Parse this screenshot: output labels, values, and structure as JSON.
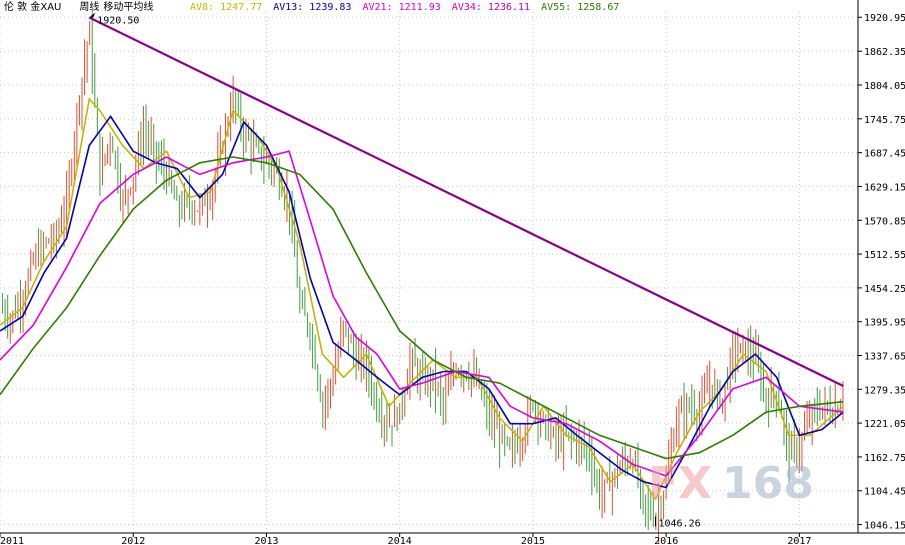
{
  "window": {
    "title_prefix": "伦 敦 金XAU",
    "period": "周线",
    "indicator": "移动平均线"
  },
  "legend": [
    {
      "label": "AV8: 1247.77",
      "color": "#c8b400"
    },
    {
      "label": "AV13: 1239.83",
      "color": "#0000c0"
    },
    {
      "label": "AV21: 1211.93",
      "color": "#e000e0"
    },
    {
      "label": "AV34: 1236.11",
      "color": "#c000c0"
    },
    {
      "label": "AV55: 1258.67",
      "color": "#2e7d00"
    }
  ],
  "annotations": {
    "high_label": "1920.50",
    "low_label": "1046.26"
  },
  "watermark": {
    "text_a": "FX",
    "text_b": "168"
  },
  "colors": {
    "up_candle": "#e05030",
    "down_candle": "#40a040",
    "ma8": "#c8b400",
    "ma13": "#0000c0",
    "ma21": "#e000e0",
    "ma34": "#c000c0",
    "ma55": "#2e7d00",
    "trendline": "#8a008a"
  },
  "chart_data": {
    "type": "candlestick",
    "title": "",
    "y_ticks": [
      "1920.95",
      "1862.35",
      "1804.05",
      "1745.75",
      "1687.45",
      "1629.15",
      "1570.85",
      "1512.55",
      "1454.25",
      "1395.95",
      "1337.65",
      "1279.35",
      "1221.05",
      "1162.75",
      "1104.45",
      "1046.15"
    ],
    "ylim": [
      1035,
      1930
    ],
    "x_ticks": [
      {
        "label": "2011",
        "x": 2011.0
      },
      {
        "label": "2012",
        "x": 2012.0
      },
      {
        "label": "2013",
        "x": 2013.0
      },
      {
        "label": "2014",
        "x": 2014.0
      },
      {
        "label": "2015",
        "x": 2015.0
      },
      {
        "label": "2016",
        "x": 2016.0
      },
      {
        "label": "2017",
        "x": 2017.0
      }
    ],
    "xlim": [
      2011.0,
      2017.35
    ],
    "high": {
      "x": 2011.67,
      "y": 1920.5
    },
    "low": {
      "x": 2015.92,
      "y": 1046.26
    },
    "trendline": {
      "x": [
        2011.67,
        2017.33
      ],
      "y": [
        1920.5,
        1285
      ]
    },
    "price_path": [
      [
        2011.0,
        1420
      ],
      [
        2011.08,
        1400
      ],
      [
        2011.17,
        1440
      ],
      [
        2011.25,
        1500
      ],
      [
        2011.33,
        1530
      ],
      [
        2011.42,
        1540
      ],
      [
        2011.5,
        1600
      ],
      [
        2011.58,
        1760
      ],
      [
        2011.67,
        1900
      ],
      [
        2011.75,
        1650
      ],
      [
        2011.83,
        1720
      ],
      [
        2011.92,
        1600
      ],
      [
        2012.0,
        1650
      ],
      [
        2012.08,
        1730
      ],
      [
        2012.17,
        1680
      ],
      [
        2012.25,
        1650
      ],
      [
        2012.33,
        1590
      ],
      [
        2012.42,
        1600
      ],
      [
        2012.5,
        1590
      ],
      [
        2012.58,
        1620
      ],
      [
        2012.67,
        1700
      ],
      [
        2012.75,
        1780
      ],
      [
        2012.83,
        1720
      ],
      [
        2012.92,
        1690
      ],
      [
        2013.0,
        1670
      ],
      [
        2013.08,
        1650
      ],
      [
        2013.17,
        1600
      ],
      [
        2013.25,
        1420
      ],
      [
        2013.33,
        1380
      ],
      [
        2013.42,
        1250
      ],
      [
        2013.5,
        1300
      ],
      [
        2013.58,
        1390
      ],
      [
        2013.67,
        1330
      ],
      [
        2013.75,
        1320
      ],
      [
        2013.83,
        1250
      ],
      [
        2013.92,
        1220
      ],
      [
        2014.0,
        1240
      ],
      [
        2014.08,
        1330
      ],
      [
        2014.17,
        1290
      ],
      [
        2014.25,
        1300
      ],
      [
        2014.33,
        1250
      ],
      [
        2014.42,
        1320
      ],
      [
        2014.5,
        1310
      ],
      [
        2014.58,
        1290
      ],
      [
        2014.67,
        1230
      ],
      [
        2014.75,
        1200
      ],
      [
        2014.83,
        1170
      ],
      [
        2014.92,
        1200
      ],
      [
        2015.0,
        1260
      ],
      [
        2015.08,
        1220
      ],
      [
        2015.17,
        1190
      ],
      [
        2015.25,
        1200
      ],
      [
        2015.33,
        1190
      ],
      [
        2015.42,
        1170
      ],
      [
        2015.5,
        1100
      ],
      [
        2015.58,
        1120
      ],
      [
        2015.67,
        1150
      ],
      [
        2015.75,
        1160
      ],
      [
        2015.83,
        1080
      ],
      [
        2015.92,
        1060
      ],
      [
        2016.0,
        1120
      ],
      [
        2016.08,
        1230
      ],
      [
        2016.17,
        1250
      ],
      [
        2016.25,
        1240
      ],
      [
        2016.33,
        1290
      ],
      [
        2016.42,
        1260
      ],
      [
        2016.5,
        1340
      ],
      [
        2016.58,
        1350
      ],
      [
        2016.67,
        1330
      ],
      [
        2016.75,
        1260
      ],
      [
        2016.83,
        1280
      ],
      [
        2016.92,
        1170
      ],
      [
        2017.0,
        1180
      ],
      [
        2017.08,
        1230
      ],
      [
        2017.17,
        1250
      ],
      [
        2017.25,
        1240
      ],
      [
        2017.33,
        1265
      ]
    ],
    "series": [
      {
        "name": "AV8",
        "color_key": "ma8",
        "values": [
          [
            2011.0,
            1390
          ],
          [
            2011.17,
            1420
          ],
          [
            2011.33,
            1500
          ],
          [
            2011.5,
            1560
          ],
          [
            2011.67,
            1780
          ],
          [
            2011.75,
            1760
          ],
          [
            2011.92,
            1700
          ],
          [
            2012.08,
            1660
          ],
          [
            2012.25,
            1690
          ],
          [
            2012.42,
            1610
          ],
          [
            2012.58,
            1620
          ],
          [
            2012.75,
            1760
          ],
          [
            2012.92,
            1720
          ],
          [
            2013.08,
            1660
          ],
          [
            2013.25,
            1530
          ],
          [
            2013.42,
            1340
          ],
          [
            2013.58,
            1300
          ],
          [
            2013.75,
            1340
          ],
          [
            2013.92,
            1250
          ],
          [
            2014.08,
            1290
          ],
          [
            2014.25,
            1330
          ],
          [
            2014.42,
            1300
          ],
          [
            2014.58,
            1300
          ],
          [
            2014.75,
            1230
          ],
          [
            2014.92,
            1190
          ],
          [
            2015.08,
            1250
          ],
          [
            2015.25,
            1200
          ],
          [
            2015.42,
            1180
          ],
          [
            2015.58,
            1120
          ],
          [
            2015.75,
            1150
          ],
          [
            2015.92,
            1090
          ],
          [
            2016.08,
            1170
          ],
          [
            2016.25,
            1240
          ],
          [
            2016.42,
            1280
          ],
          [
            2016.58,
            1340
          ],
          [
            2016.75,
            1310
          ],
          [
            2016.92,
            1200
          ],
          [
            2017.08,
            1200
          ],
          [
            2017.33,
            1250
          ]
        ]
      },
      {
        "name": "AV13",
        "color_key": "ma13",
        "values": [
          [
            2011.0,
            1380
          ],
          [
            2011.17,
            1405
          ],
          [
            2011.33,
            1480
          ],
          [
            2011.5,
            1540
          ],
          [
            2011.67,
            1700
          ],
          [
            2011.83,
            1750
          ],
          [
            2012.0,
            1690
          ],
          [
            2012.17,
            1670
          ],
          [
            2012.33,
            1660
          ],
          [
            2012.5,
            1610
          ],
          [
            2012.67,
            1650
          ],
          [
            2012.83,
            1740
          ],
          [
            2013.0,
            1700
          ],
          [
            2013.17,
            1620
          ],
          [
            2013.33,
            1470
          ],
          [
            2013.5,
            1360
          ],
          [
            2013.67,
            1330
          ],
          [
            2013.83,
            1300
          ],
          [
            2014.0,
            1270
          ],
          [
            2014.17,
            1300
          ],
          [
            2014.33,
            1310
          ],
          [
            2014.5,
            1310
          ],
          [
            2014.67,
            1280
          ],
          [
            2014.83,
            1220
          ],
          [
            2015.0,
            1220
          ],
          [
            2015.17,
            1230
          ],
          [
            2015.33,
            1200
          ],
          [
            2015.5,
            1170
          ],
          [
            2015.67,
            1140
          ],
          [
            2015.83,
            1120
          ],
          [
            2016.0,
            1110
          ],
          [
            2016.17,
            1180
          ],
          [
            2016.33,
            1250
          ],
          [
            2016.5,
            1310
          ],
          [
            2016.67,
            1340
          ],
          [
            2016.83,
            1300
          ],
          [
            2017.0,
            1200
          ],
          [
            2017.17,
            1210
          ],
          [
            2017.33,
            1240
          ]
        ]
      },
      {
        "name": "AV21",
        "color_key": "ma21",
        "values": [
          [
            2011.0,
            1330
          ],
          [
            2011.25,
            1390
          ],
          [
            2011.5,
            1490
          ],
          [
            2011.75,
            1600
          ],
          [
            2012.0,
            1650
          ],
          [
            2012.25,
            1680
          ],
          [
            2012.5,
            1650
          ],
          [
            2012.75,
            1670
          ],
          [
            2013.0,
            1680
          ],
          [
            2013.17,
            1690
          ],
          [
            2013.33,
            1570
          ],
          [
            2013.5,
            1440
          ],
          [
            2013.67,
            1370
          ],
          [
            2013.83,
            1340
          ],
          [
            2014.0,
            1280
          ],
          [
            2014.17,
            1290
          ],
          [
            2014.42,
            1310
          ],
          [
            2014.67,
            1300
          ],
          [
            2014.83,
            1250
          ],
          [
            2015.0,
            1230
          ],
          [
            2015.25,
            1220
          ],
          [
            2015.5,
            1190
          ],
          [
            2015.75,
            1150
          ],
          [
            2016.0,
            1130
          ],
          [
            2016.25,
            1200
          ],
          [
            2016.5,
            1280
          ],
          [
            2016.75,
            1300
          ],
          [
            2017.0,
            1250
          ],
          [
            2017.33,
            1240
          ]
        ]
      },
      {
        "name": "AV55",
        "color_key": "ma55",
        "values": [
          [
            2011.0,
            1270
          ],
          [
            2011.25,
            1350
          ],
          [
            2011.5,
            1420
          ],
          [
            2011.75,
            1510
          ],
          [
            2012.0,
            1590
          ],
          [
            2012.25,
            1640
          ],
          [
            2012.5,
            1670
          ],
          [
            2012.75,
            1680
          ],
          [
            2013.0,
            1670
          ],
          [
            2013.25,
            1650
          ],
          [
            2013.5,
            1590
          ],
          [
            2013.75,
            1480
          ],
          [
            2014.0,
            1380
          ],
          [
            2014.25,
            1330
          ],
          [
            2014.5,
            1300
          ],
          [
            2014.75,
            1290
          ],
          [
            2015.0,
            1260
          ],
          [
            2015.25,
            1230
          ],
          [
            2015.5,
            1200
          ],
          [
            2015.75,
            1180
          ],
          [
            2016.0,
            1160
          ],
          [
            2016.25,
            1170
          ],
          [
            2016.5,
            1200
          ],
          [
            2016.75,
            1240
          ],
          [
            2017.0,
            1250
          ],
          [
            2017.33,
            1258
          ]
        ]
      }
    ]
  }
}
